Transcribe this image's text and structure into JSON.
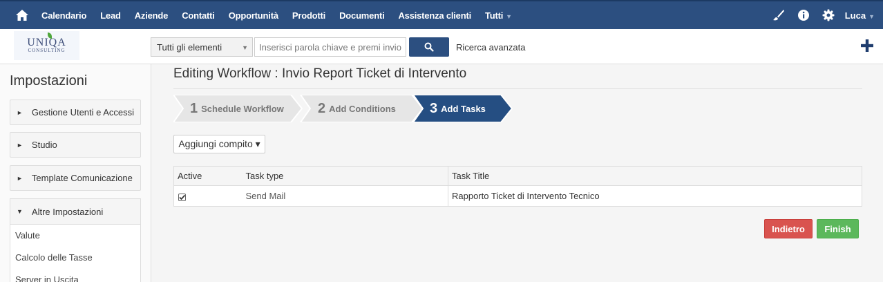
{
  "topnav": {
    "items": [
      {
        "label": "Calendario"
      },
      {
        "label": "Lead"
      },
      {
        "label": "Aziende"
      },
      {
        "label": "Contatti"
      },
      {
        "label": "Opportunità"
      },
      {
        "label": "Prodotti"
      },
      {
        "label": "Documenti"
      },
      {
        "label": "Assistenza clienti"
      },
      {
        "label": "Tutti"
      }
    ],
    "user": "Luca",
    "color": "#2c4f80"
  },
  "subbar": {
    "logo_main": "UNIQA",
    "logo_sub": "CONSULTING",
    "scope_value": "Tutti gli elementi",
    "search_placeholder": "Inserisci parola chiave e premi invio",
    "advanced_search": "Ricerca avanzata"
  },
  "sidebar": {
    "title": "Impostazioni",
    "panels": [
      {
        "label": "Gestione Utenti e Accessi"
      },
      {
        "label": "Studio"
      },
      {
        "label": "Template Comunicazione"
      }
    ],
    "open_panel": {
      "label": "Altre Impostazioni",
      "items": [
        "Valute",
        "Calcolo delle Tasse",
        "Server in Uscita"
      ]
    }
  },
  "main": {
    "title": "Editing Workflow : Invio Report Ticket di Intervento",
    "steps": [
      {
        "num": "1",
        "label": "Schedule Workflow",
        "active": false
      },
      {
        "num": "2",
        "label": "Add Conditions",
        "active": false
      },
      {
        "num": "3",
        "label": "Add Tasks",
        "active": true
      }
    ],
    "add_task_button": "Aggiungi compito ▾",
    "table": {
      "headers": [
        "Active",
        "Task type",
        "Task Title"
      ],
      "rows": [
        {
          "active": true,
          "type": "Send Mail",
          "title": "Rapporto Ticket di Intervento Tecnico"
        }
      ]
    },
    "back_button": "Indietro",
    "finish_button": "Finish"
  },
  "colors": {
    "step_active": "#254e82",
    "step_inactive": "#e6e6e6",
    "danger": "#d9534f",
    "success": "#5cb85c"
  }
}
